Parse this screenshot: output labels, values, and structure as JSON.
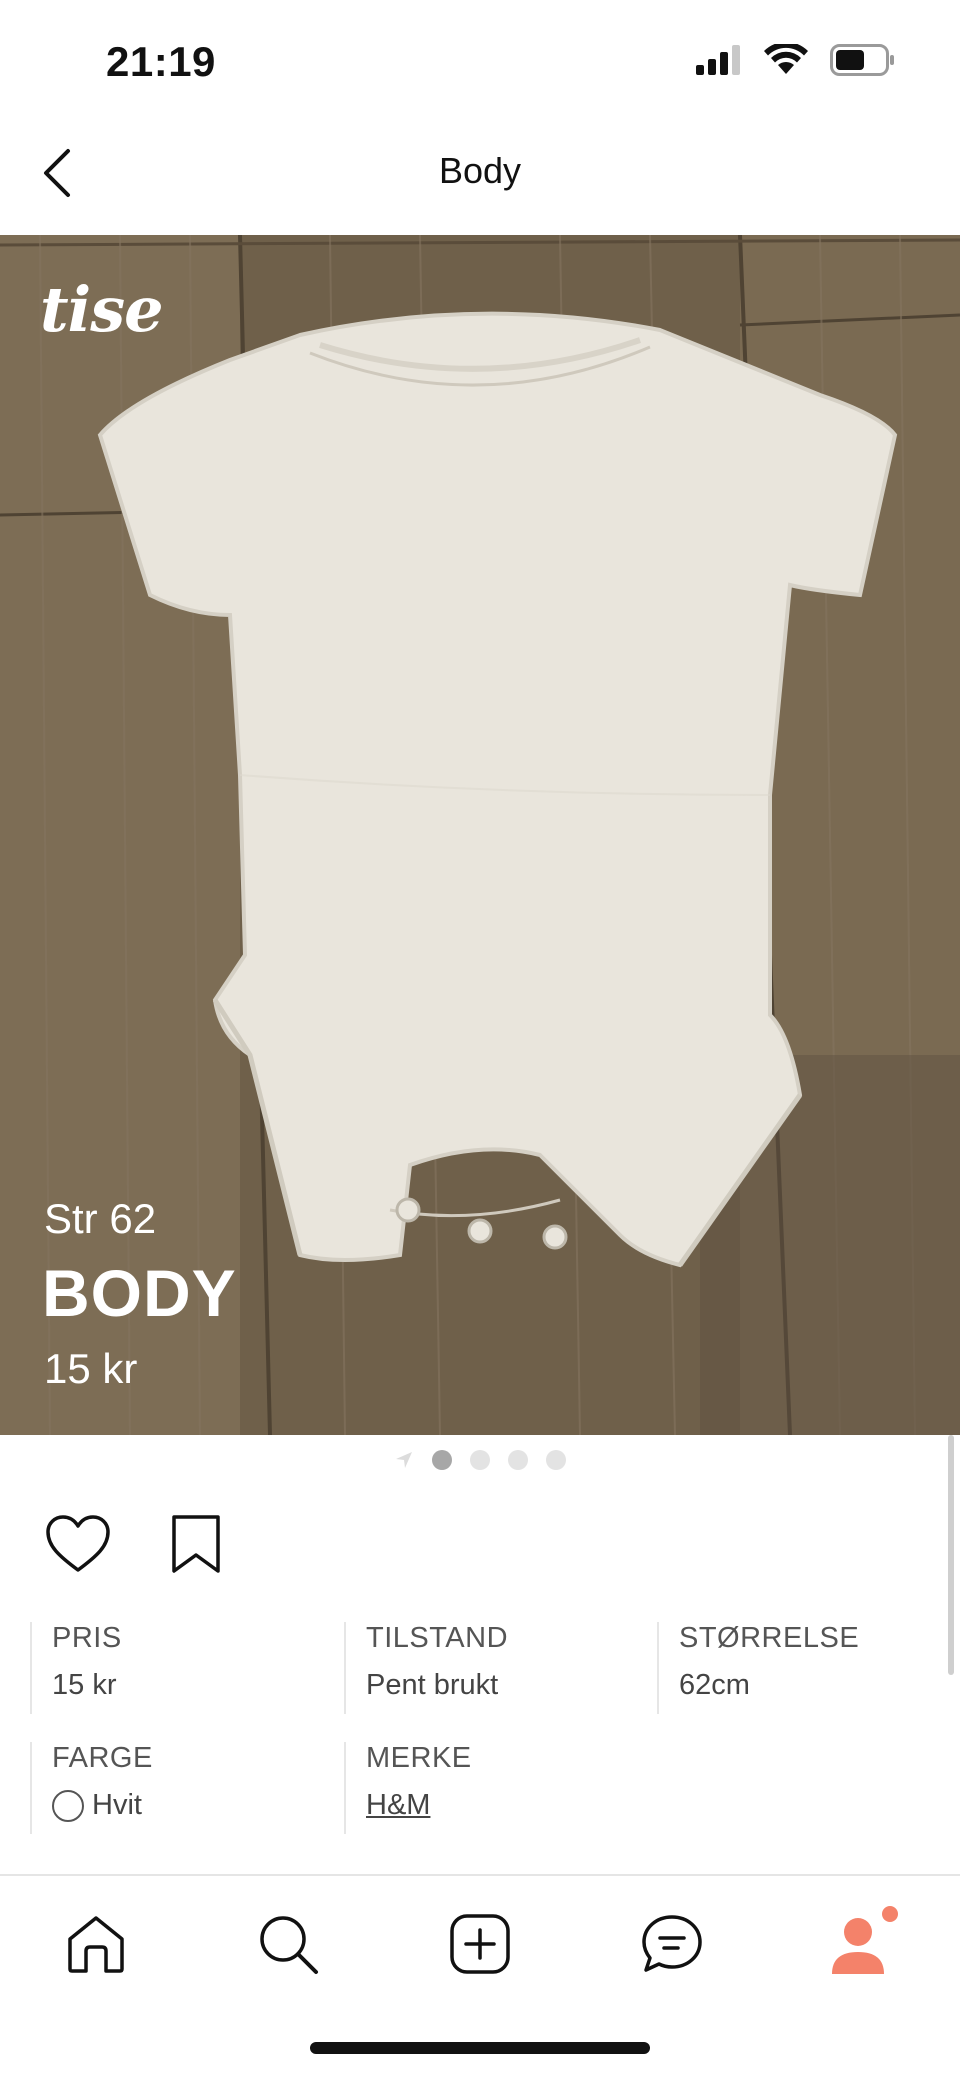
{
  "status_bar": {
    "time": "21:19"
  },
  "nav": {
    "title": "Body"
  },
  "listing": {
    "logo": "tise",
    "size_overlay": "Str 62",
    "title_overlay": "BODY",
    "price_overlay": "15 kr",
    "image_count": 4,
    "active_image": 1
  },
  "attributes": {
    "price": {
      "label": "PRIS",
      "value": "15 kr"
    },
    "condition": {
      "label": "TILSTAND",
      "value": "Pent brukt"
    },
    "size": {
      "label": "STØRRELSE",
      "value": "62cm"
    },
    "color": {
      "label": "FARGE",
      "value": "Hvit",
      "swatch": "#ffffff"
    },
    "brand": {
      "label": "MERKE",
      "value": "H&M"
    }
  },
  "tab_bar": {
    "items": [
      "home-icon",
      "search-icon",
      "add-icon",
      "chat-icon",
      "profile-icon"
    ],
    "active": "profile-icon"
  },
  "colors": {
    "accent": "#f4826a",
    "text": "#111111",
    "muted": "#555555"
  }
}
